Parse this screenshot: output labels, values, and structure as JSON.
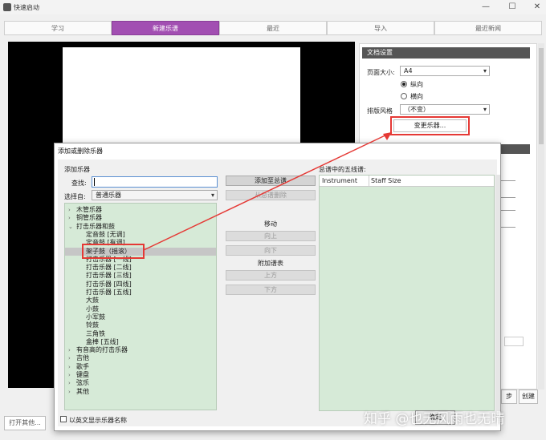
{
  "window": {
    "title": "快速启动",
    "min": "—",
    "max": "☐",
    "close": "✕"
  },
  "tabs": [
    {
      "label": "学习"
    },
    {
      "label": "新建乐谱",
      "active": true
    },
    {
      "label": "最近"
    },
    {
      "label": "导入"
    },
    {
      "label": "最近新闻"
    }
  ],
  "doc_settings": {
    "header": "文档设置",
    "page_size_label": "页面大小:",
    "page_size_value": "A4",
    "portrait": "纵向",
    "landscape": "横向",
    "style_label": "排版风格",
    "style_value": "（不变）",
    "change_instruments": "变更乐器..."
  },
  "bottom_bar": {
    "open_other": "打开其他...",
    "prev": "步",
    "create": "创建"
  },
  "dialog": {
    "title": "添加或删除乐器",
    "add_section": "添加乐器",
    "find_label": "查找:",
    "find_value": "",
    "choose_label": "选择自:",
    "choose_value": "普通乐器",
    "tree": [
      {
        "label": "木管乐器",
        "level": 0,
        "arrow": "›"
      },
      {
        "label": "铜管乐器",
        "level": 0,
        "arrow": "›"
      },
      {
        "label": "打击乐器和鼓",
        "level": 0,
        "arrow": "⌄"
      },
      {
        "label": "定音鼓 [无调]",
        "level": 1
      },
      {
        "label": "定音鼓 [有调]",
        "level": 1
      },
      {
        "label": "架子鼓（摇滚）",
        "level": 1,
        "selected": true
      },
      {
        "label": "打击乐器 [一线]",
        "level": 1
      },
      {
        "label": "打击乐器 [二线]",
        "level": 1
      },
      {
        "label": "打击乐器 [三线]",
        "level": 1
      },
      {
        "label": "打击乐器 [四线]",
        "level": 1
      },
      {
        "label": "打击乐器 [五线]",
        "level": 1
      },
      {
        "label": "大鼓",
        "level": 1
      },
      {
        "label": "小鼓",
        "level": 1
      },
      {
        "label": "小军鼓",
        "level": 1
      },
      {
        "label": "铃鼓",
        "level": 1
      },
      {
        "label": "三角铁",
        "level": 1
      },
      {
        "label": "盒棒 [五线]",
        "level": 1
      },
      {
        "label": "有音高的打击乐器",
        "level": 0,
        "arrow": "›"
      },
      {
        "label": "吉他",
        "level": 0,
        "arrow": "›"
      },
      {
        "label": "歌手",
        "level": 0,
        "arrow": "›"
      },
      {
        "label": "键盘",
        "level": 0,
        "arrow": "›"
      },
      {
        "label": "弦乐",
        "level": 0,
        "arrow": "›"
      },
      {
        "label": "其他",
        "level": 0,
        "arrow": "›"
      }
    ],
    "add_to_score": "添加至总谱",
    "remove_from_score": "从总谱删除",
    "move_label": "移动",
    "up": "向上",
    "down": "向下",
    "extra_staff_label": "附加谱表",
    "above": "上方",
    "below": "下方",
    "staves_section": "总谱中的五线谱:",
    "col_instrument": "Instrument",
    "col_staff_size": "Staff Size",
    "english_names": "以英文显示乐器名称",
    "ok": "确定"
  },
  "watermark": "知乎 @也无风雨也无晴",
  "colors": {
    "accent_tab": "#a24fb2",
    "list_bg": "#d6ead7",
    "annotation": "#e53935"
  }
}
